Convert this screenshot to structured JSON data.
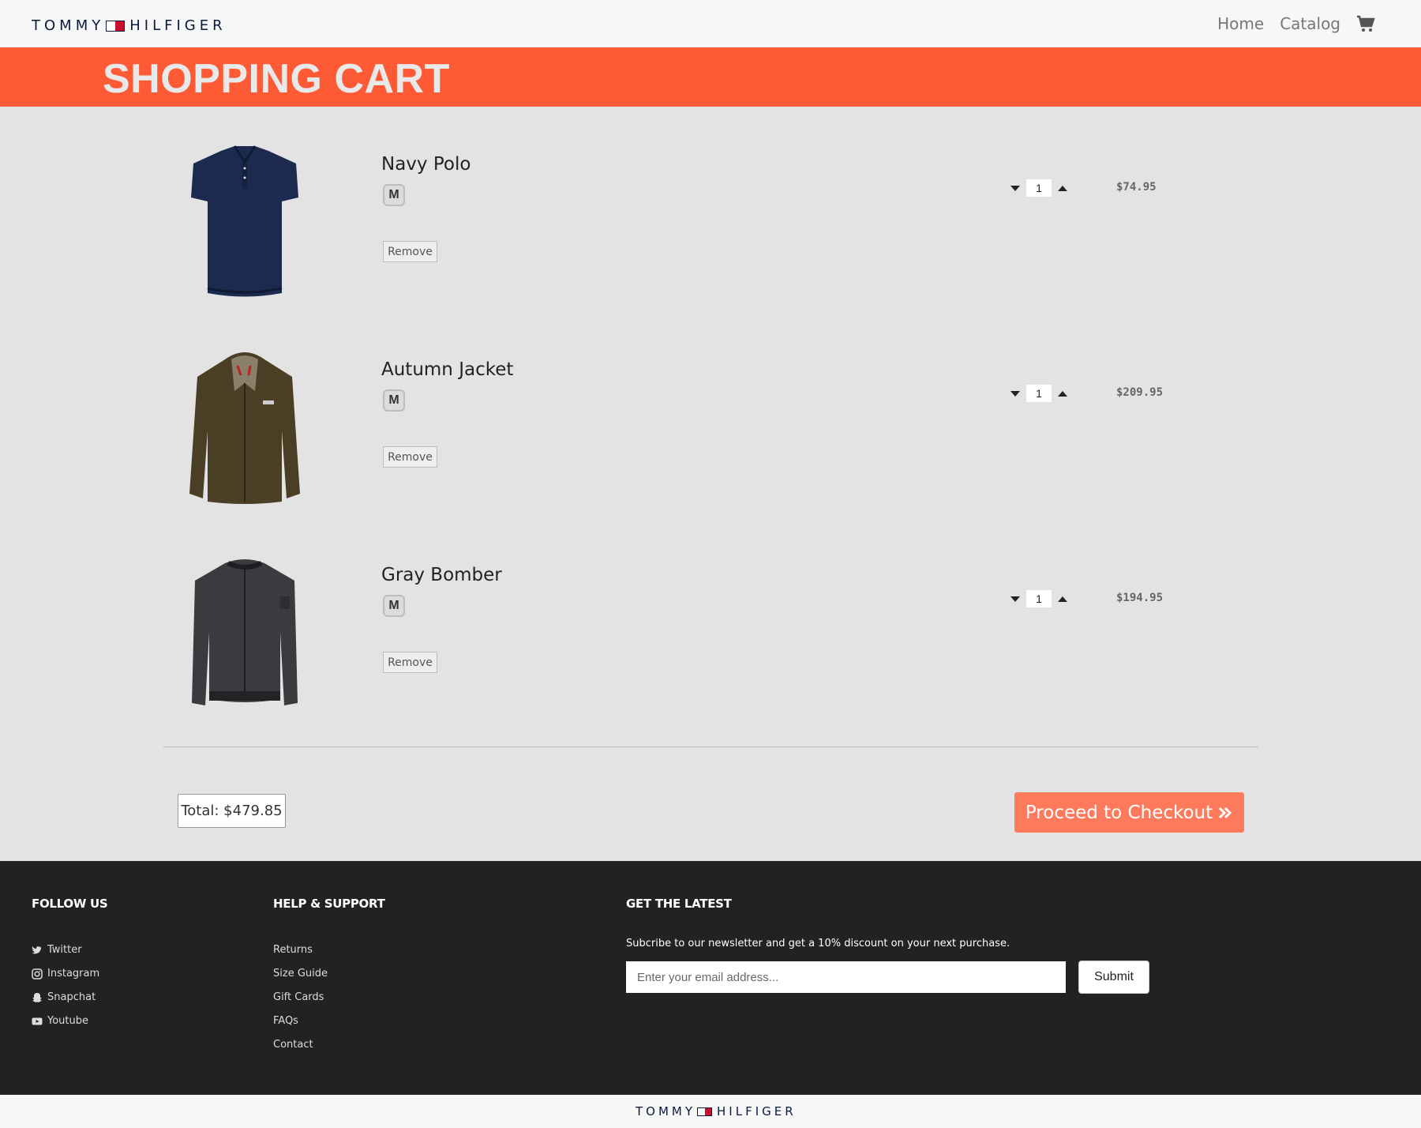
{
  "header": {
    "logo_left": "TOMMY",
    "logo_right": "HILFIGER",
    "nav": {
      "home": "Home",
      "catalog": "Catalog"
    },
    "cart_icon": "shopping-cart-icon"
  },
  "banner": {
    "title": "SHOPPING CART"
  },
  "cart": {
    "items": [
      {
        "name": "Navy Polo",
        "size": "M",
        "remove": "Remove",
        "qty": "1",
        "price": "$74.95"
      },
      {
        "name": "Autumn Jacket",
        "size": "M",
        "remove": "Remove",
        "qty": "1",
        "price": "$209.95"
      },
      {
        "name": "Gray Bomber",
        "size": "M",
        "remove": "Remove",
        "qty": "1",
        "price": "$194.95"
      }
    ],
    "total": "Total: $479.85",
    "checkout": "Proceed to Checkout",
    "checkout_icon": "double-chevron-right-icon"
  },
  "footer": {
    "follow": {
      "title": "FOLLOW US",
      "links": [
        "Twitter",
        "Instagram",
        "Snapchat",
        "Youtube"
      ]
    },
    "help": {
      "title": "HELP & SUPPORT",
      "links": [
        "Returns",
        "Size Guide",
        "Gift Cards",
        "FAQs",
        "Contact"
      ]
    },
    "latest": {
      "title": "GET THE LATEST",
      "text": "Subcribe to our newsletter and get a 10% discount on your next purchase.",
      "placeholder": "Enter your email address...",
      "submit": "Submit"
    }
  },
  "bottom": {
    "logo_left": "TOMMY",
    "logo_right": "HILFIGER"
  },
  "colors": {
    "accent": "#ff5a36",
    "checkout": "#ff7a5c",
    "footer_bg": "#222222",
    "navy": "#0a1a3f"
  }
}
